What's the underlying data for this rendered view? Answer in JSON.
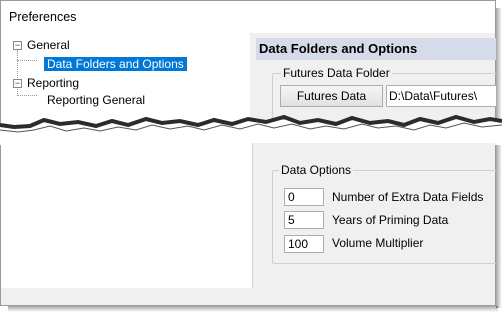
{
  "window": {
    "title": "Preferences"
  },
  "tree": {
    "items": [
      {
        "label": "General",
        "expander": "−"
      },
      {
        "label": "Data Folders and Options"
      },
      {
        "label": "Reporting",
        "expander": "−"
      },
      {
        "label": "Reporting General"
      }
    ]
  },
  "panel": {
    "header": "Data Folders and Options",
    "futures_group": {
      "label": "Futures Data Folder",
      "button": "Futures Data",
      "path": "D:\\Data\\Futures\\"
    },
    "options_group": {
      "label": "Data Options",
      "options": [
        {
          "value": "0",
          "label": "Number of Extra Data Fields"
        },
        {
          "value": "5",
          "label": "Years of Priming Data"
        },
        {
          "value": "100",
          "label": "Volume Multiplier"
        }
      ]
    }
  },
  "colors": {
    "selection": "#0078d7",
    "header_bg": "#d6dbe9"
  }
}
